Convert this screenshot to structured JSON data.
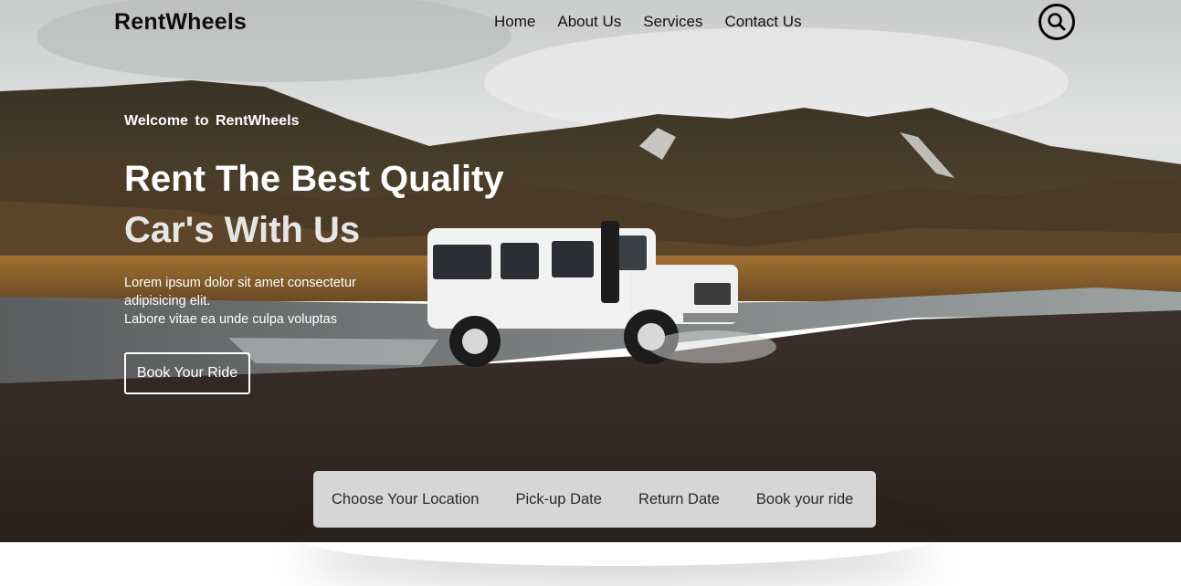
{
  "brand": {
    "name": "RentWheels"
  },
  "nav": {
    "items": [
      {
        "label": "Home"
      },
      {
        "label": "About Us"
      },
      {
        "label": "Services"
      },
      {
        "label": "Contact Us"
      }
    ],
    "search_icon": "search-icon"
  },
  "hero": {
    "welcome": "Welcome  to  RentWheels",
    "headline_line1": "Rent The Best Quality",
    "headline_line2": "Car's With Us",
    "description_line1": "Lorem ipsum dolor sit amet consectetur",
    "description_line2": "adipisicing elit.",
    "description_line3": "Labore vitae ea unde culpa voluptas",
    "cta_label": "Book Your Ride"
  },
  "booking_bar": {
    "items": [
      {
        "label": "Choose Your Location"
      },
      {
        "label": "Pick-up Date"
      },
      {
        "label": "Return Date"
      },
      {
        "label": "Book your ride"
      }
    ]
  },
  "colors": {
    "brand_text": "#0d0d0d",
    "hero_text": "#ffffff",
    "booking_bar_bg": "#e4e4e4"
  }
}
